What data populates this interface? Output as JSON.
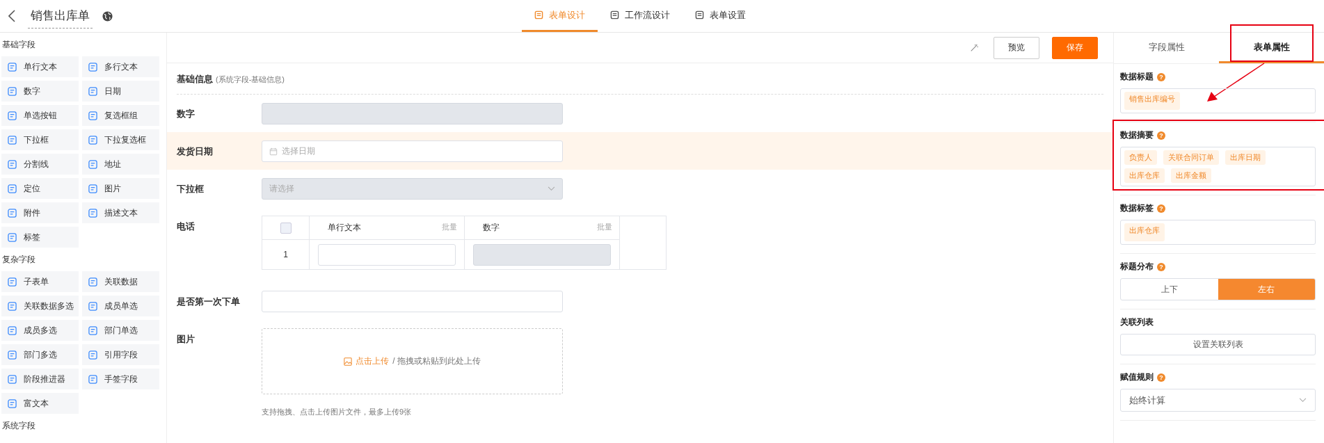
{
  "header": {
    "title": "销售出库单",
    "tabs": [
      {
        "label": "表单设计",
        "selected": true
      },
      {
        "label": "工作流设计",
        "selected": false
      },
      {
        "label": "表单设置",
        "selected": false
      }
    ]
  },
  "field_palette": {
    "groups": [
      {
        "title": "基础字段",
        "items": [
          "单行文本",
          "多行文本",
          "数字",
          "日期",
          "单选按钮",
          "复选框组",
          "下拉框",
          "下拉复选框",
          "分割线",
          "地址",
          "定位",
          "图片",
          "附件",
          "描述文本",
          "标签"
        ]
      },
      {
        "title": "复杂字段",
        "items": [
          "子表单",
          "关联数据",
          "关联数据多选",
          "成员单选",
          "成员多选",
          "部门单选",
          "部门多选",
          "引用字段",
          "阶段推进器",
          "手签字段",
          "富文本"
        ]
      },
      {
        "title": "系统字段"
      }
    ]
  },
  "toolbar": {
    "buttons": [
      {
        "label": "预览",
        "kind": "default"
      },
      {
        "label": "保存",
        "kind": "primary"
      }
    ]
  },
  "form": {
    "section": {
      "title": "基础信息",
      "note": "(系统字段-基础信息)"
    },
    "fields": [
      {
        "label": "数字",
        "kind": "input",
        "disabled": true,
        "selected": false
      },
      {
        "label": "发货日期",
        "kind": "date",
        "placeholder": "选择日期",
        "disabled": false,
        "selected": true
      },
      {
        "label": "下拉框",
        "kind": "select",
        "placeholder": "请选择",
        "disabled": true,
        "selected": false
      },
      {
        "label": "电话",
        "kind": "subtable",
        "selected": false,
        "all_checked": false,
        "columns": [
          {
            "title": "单行文本",
            "action": "批量",
            "disabled": false
          },
          {
            "title": "数字",
            "action": "批量",
            "disabled": true
          }
        ],
        "rows": [
          "1"
        ]
      },
      {
        "label": "是否第一次下单",
        "kind": "input",
        "disabled": false,
        "selected": false
      },
      {
        "label": "图片",
        "kind": "upload",
        "selected": false,
        "link": "点击上传",
        "text": "/ 拖拽或粘贴到此处上传",
        "hint": "支持拖拽、点击上传图片文件，最多上传9张"
      }
    ]
  },
  "properties": {
    "tabs": [
      {
        "label": "字段属性",
        "selected": false,
        "annotated": false
      },
      {
        "label": "表单属性",
        "selected": true,
        "annotated": true
      }
    ],
    "sections": [
      {
        "title": "数据标题",
        "help": "?",
        "kind": "tags",
        "annotated": false,
        "tags": [
          "销售出库编号"
        ]
      },
      {
        "title": "数据摘要",
        "help": "?",
        "kind": "tags",
        "annotated": true,
        "tags": [
          "负责人",
          "关联合同订单",
          "出库日期",
          "出库仓库",
          "出库金额"
        ]
      },
      {
        "title": "数据标签",
        "help": "?",
        "kind": "tags",
        "annotated": false,
        "tags": [
          "出库仓库"
        ]
      },
      {
        "title": "标题分布",
        "help": "?",
        "kind": "segmented",
        "annotated": false,
        "options": [
          {
            "label": "上下",
            "selected": false
          },
          {
            "label": "左右",
            "selected": true
          }
        ]
      },
      {
        "title": "关联列表",
        "kind": "button",
        "annotated": false,
        "button": "设置关联列表"
      },
      {
        "title": "赋值规则",
        "help": "?",
        "kind": "select",
        "annotated": false,
        "value": "始终计算"
      }
    ]
  }
}
